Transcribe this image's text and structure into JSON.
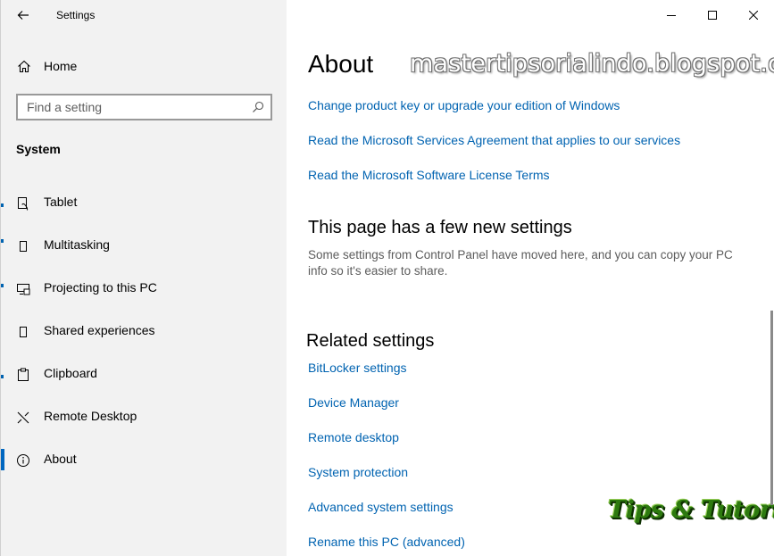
{
  "app": {
    "title": "Settings"
  },
  "nav": {
    "home_label": "Home",
    "search_placeholder": "Find a setting",
    "section_title": "System",
    "items": [
      {
        "label": "Tablet",
        "icon": "tablet-icon",
        "selected": false
      },
      {
        "label": "Multitasking",
        "icon": "multitasking-icon",
        "selected": false
      },
      {
        "label": "Projecting to this PC",
        "icon": "projecting-icon",
        "selected": false
      },
      {
        "label": "Shared experiences",
        "icon": "shared-experiences-icon",
        "selected": false
      },
      {
        "label": "Clipboard",
        "icon": "clipboard-icon",
        "selected": false
      },
      {
        "label": "Remote Desktop",
        "icon": "remote-desktop-icon",
        "selected": false
      },
      {
        "label": "About",
        "icon": "info-icon",
        "selected": true
      }
    ]
  },
  "main": {
    "title": "About",
    "links_top": [
      "Change product key or upgrade your edition of Windows",
      "Read the Microsoft Services Agreement that applies to our services",
      "Read the Microsoft Software License Terms"
    ],
    "new_settings": {
      "heading": "This page has a few new settings",
      "description": "Some settings from Control Panel have moved here, and you can copy your PC info so it's easier to share."
    },
    "related": {
      "heading": "Related settings",
      "links": [
        "BitLocker settings",
        "Device Manager",
        "Remote desktop",
        "System protection",
        "Advanced system settings",
        "Rename this PC (advanced)"
      ]
    }
  },
  "watermark": {
    "text": "mastertipsorialindo.blogspot.com"
  },
  "logo": {
    "text": "Tips & Tutorial"
  },
  "colors": {
    "accent": "#0063b1",
    "nav_background": "#f2f2f2",
    "content_background": "#ffffff",
    "logo_green": "#2d7a0f"
  }
}
